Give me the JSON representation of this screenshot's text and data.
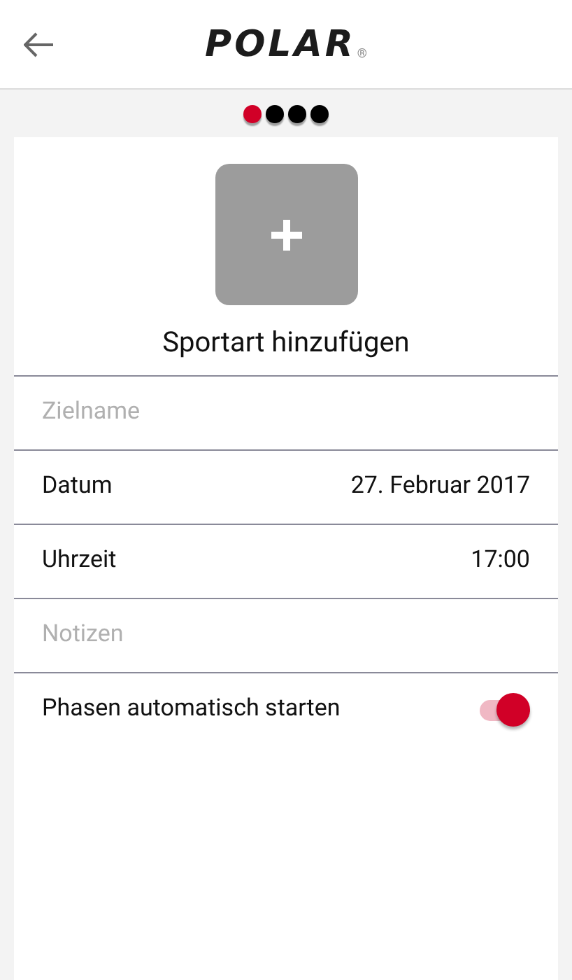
{
  "header": {
    "logo": "POLAR",
    "registered_mark": "®"
  },
  "page_dots": [
    {
      "selected": true
    },
    {
      "selected": false
    },
    {
      "selected": false
    },
    {
      "selected": false
    }
  ],
  "sport": {
    "label": "Sportart hinzufügen"
  },
  "fields": [
    {
      "kind": "input",
      "placeholder": "Zielname"
    },
    {
      "kind": "value",
      "label": "Datum",
      "value": "27. Februar 2017"
    },
    {
      "kind": "value",
      "label": "Uhrzeit",
      "value": "17:00"
    },
    {
      "kind": "input",
      "placeholder": "Notizen"
    },
    {
      "kind": "toggle",
      "label": "Phasen automatisch starten",
      "on": true
    }
  ]
}
